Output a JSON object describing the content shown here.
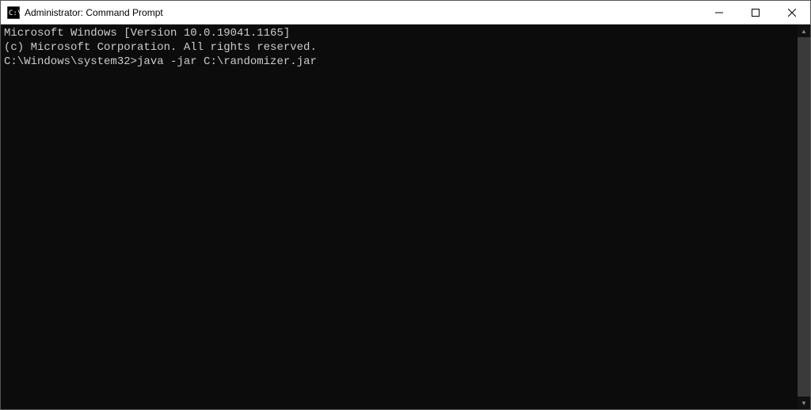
{
  "titlebar": {
    "title": "Administrator: Command Prompt"
  },
  "terminal": {
    "line1": "Microsoft Windows [Version 10.0.19041.1165]",
    "line2": "(c) Microsoft Corporation. All rights reserved.",
    "line3": "",
    "prompt": "C:\\Windows\\system32>",
    "command": "java -jar C:\\randomizer.jar"
  }
}
